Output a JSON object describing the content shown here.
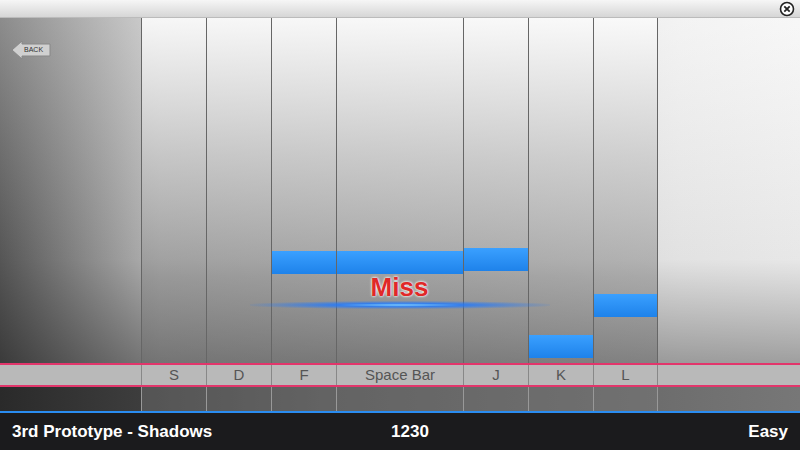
{
  "back_button": {
    "label": "BACK"
  },
  "lanes": [
    {
      "key": "S",
      "notes": []
    },
    {
      "key": "D",
      "notes": []
    },
    {
      "key": "F",
      "notes": [
        {
          "level": 0.707
        }
      ]
    },
    {
      "key": "Space Bar",
      "notes": [
        {
          "level": 0.707
        }
      ]
    },
    {
      "key": "J",
      "notes": [
        {
          "level": 0.699
        }
      ]
    },
    {
      "key": "K",
      "notes": [
        {
          "level": 0.951
        }
      ]
    },
    {
      "key": "L",
      "notes": [
        {
          "level": 0.832
        }
      ]
    }
  ],
  "judgement": "Miss",
  "footer": {
    "song": "3rd Prototype - Shadows",
    "score": "1230",
    "difficulty": "Easy"
  }
}
